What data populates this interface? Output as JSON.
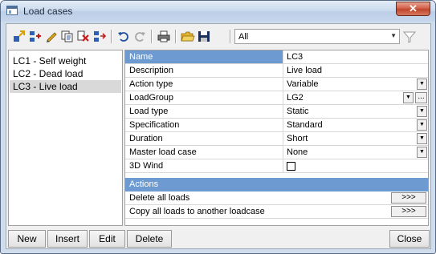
{
  "window": {
    "title": "Load cases",
    "close_label": "✕"
  },
  "toolbar": {
    "filter_value": "All",
    "icons": [
      "add-load-case-icon",
      "insert-load-case-icon",
      "edit-icon",
      "copy-icon",
      "delete-icon",
      "move-icon",
      "undo-icon",
      "redo-icon",
      "print-icon",
      "open-folder-icon",
      "save-icon",
      "filter-icon"
    ]
  },
  "load_cases": [
    {
      "label": "LC1 - Self weight",
      "selected": false
    },
    {
      "label": "LC2 - Dead load",
      "selected": false
    },
    {
      "label": "LC3 - Live load",
      "selected": true
    }
  ],
  "properties": [
    {
      "name": "Name",
      "value": "LC3",
      "control": "none",
      "selected": true
    },
    {
      "name": "Description",
      "value": "Live load",
      "control": "none"
    },
    {
      "name": "Action type",
      "value": "Variable",
      "control": "dropdown"
    },
    {
      "name": "LoadGroup",
      "value": "LG2",
      "control": "dropdown-dots"
    },
    {
      "name": "Load type",
      "value": "Static",
      "control": "dropdown"
    },
    {
      "name": "Specification",
      "value": "Standard",
      "control": "dropdown"
    },
    {
      "name": "Duration",
      "value": "Short",
      "control": "dropdown"
    },
    {
      "name": "Master load case",
      "value": "None",
      "control": "dropdown"
    },
    {
      "name": "3D Wind",
      "value": "",
      "control": "checkbox",
      "checked": false
    }
  ],
  "actions": {
    "header": "Actions",
    "items": [
      {
        "label": "Delete all loads",
        "button": ">>>"
      },
      {
        "label": "Copy all loads to another loadcase",
        "button": ">>>"
      }
    ]
  },
  "buttons": {
    "new": "New",
    "insert": "Insert",
    "edit": "Edit",
    "delete": "Delete",
    "close": "Close"
  },
  "colors": {
    "selection": "#6d9bd1",
    "list_selection": "#d9d9d9",
    "close_button": "#c0452d"
  }
}
